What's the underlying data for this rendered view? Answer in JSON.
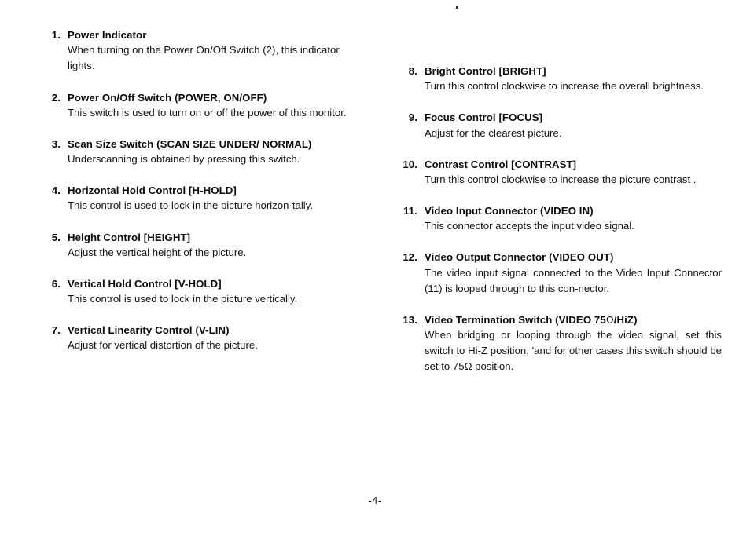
{
  "document": {
    "page_number_label": "-4-"
  },
  "left_column": {
    "entries": [
      {
        "number": "1.",
        "heading": "Power Indicator",
        "body": "When turning on the Power On/Off Switch (2), this indicator lights."
      },
      {
        "number": "2.",
        "heading": "Power On/Off Switch (POWER, ON/OFF)",
        "body": "This switch is used to turn on or off the power of this monitor."
      },
      {
        "number": "3.",
        "heading": "Scan Size Switch (SCAN SIZE UNDER/ NORMAL)",
        "body": "Underscanning is obtained by pressing this switch."
      },
      {
        "number": "4.",
        "heading": "Horizontal Hold Control [H-HOLD]",
        "body": "This control is used to lock in the picture horizon-tally."
      },
      {
        "number": "5.",
        "heading": "Height Control [HEIGHT]",
        "body": "Adjust the vertical height of the picture."
      },
      {
        "number": "6.",
        "heading": "Vertical Hold Control [V-HOLD]",
        "body": "This control is used to lock in the picture vertically."
      },
      {
        "number": "7.",
        "heading": "Vertical Linearity Control (V-LIN)",
        "body": "Adjust for vertical distortion of the picture."
      }
    ]
  },
  "right_column": {
    "entries": [
      {
        "number": "8.",
        "heading": "Bright Control [BRIGHT]",
        "body": "Turn this control clockwise to increase the overall brightness."
      },
      {
        "number": "9.",
        "heading": "Focus Control [FOCUS]",
        "body": "Adjust for the clearest picture."
      },
      {
        "number": "10.",
        "heading": "Contrast Control [CONTRAST]",
        "body": "Turn this control clockwise to increase the picture contrast ."
      },
      {
        "number": "11.",
        "heading": "Video Input Connector (VIDEO IN)",
        "body": "This connector accepts the input video signal."
      },
      {
        "number": "12.",
        "heading": "Video Output Connector (VIDEO OUT)",
        "body": "The video input signal connected to the Video Input Connector (11) is looped through to this con-nector."
      },
      {
        "number": "13.",
        "heading_prefix": "Video Termination Switch (VIDEO 75",
        "heading_omega": "Ω",
        "heading_suffix": "/HiZ)",
        "body_part1": "When bridging or looping through the video signal, set this switch to Hi-Z position, 'and for other cases this switch should be set to 75",
        "body_omega": "Ω",
        "body_part2": " position."
      }
    ]
  }
}
